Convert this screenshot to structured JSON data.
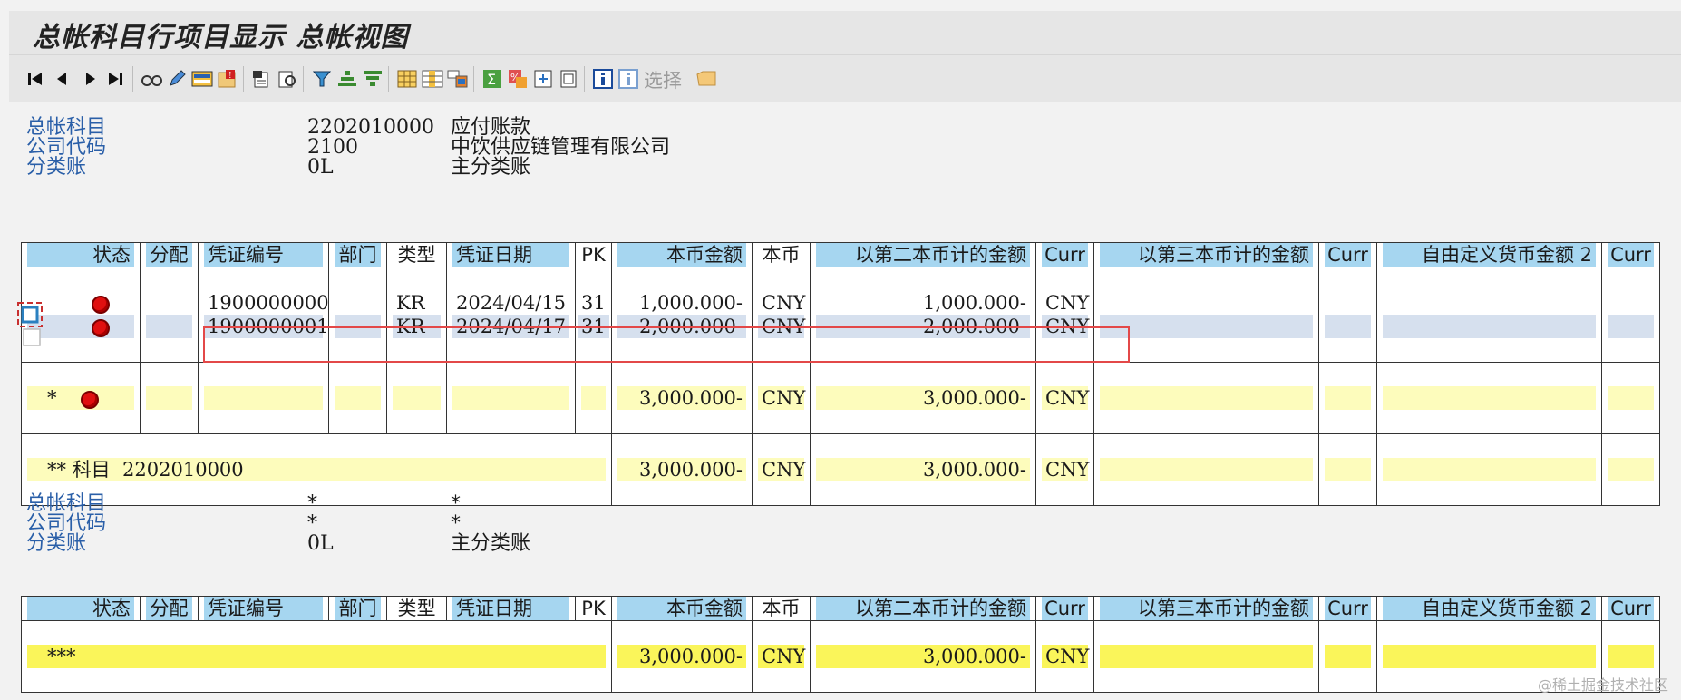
{
  "window": {
    "title": "总帐科目行项目显示 总帐视图"
  },
  "toolbar": {
    "icons": [
      "first-page-icon",
      "previous-page-icon",
      "next-page-icon",
      "last-page-icon",
      "glasses-icon",
      "pencil-icon",
      "layout-icon",
      "exception-icon",
      "document-icon",
      "find-icon",
      "filter-icon",
      "sort-ascending-icon",
      "sort-descending-icon",
      "table-icon",
      "columns-icon",
      "subtotal-layout-icon",
      "sum-icon",
      "subtotal-icon",
      "export-icon",
      "print-icon",
      "info-icon",
      "info-select-icon",
      "folder-icon"
    ],
    "select_label": "选择"
  },
  "header1": {
    "rows": [
      {
        "label": "总帐科目",
        "value": "2202010000",
        "desc": "应付账款"
      },
      {
        "label": "公司代码",
        "value": "2100",
        "desc": "中饮供应链管理有限公司"
      },
      {
        "label": "分类账",
        "value": "0L",
        "desc": "主分类账"
      }
    ]
  },
  "header2": {
    "rows": [
      {
        "label": "总帐科目",
        "value": "*",
        "desc": "*"
      },
      {
        "label": "公司代码",
        "value": "*",
        "desc": "*"
      },
      {
        "label": "分类账",
        "value": "0L",
        "desc": "主分类账"
      }
    ]
  },
  "columns": [
    "状态",
    "分配",
    "凭证编号",
    "部门",
    "类型",
    "凭证日期",
    "PK",
    "本币金额",
    "本币",
    "以第二本币计的金额",
    "Curr",
    "以第三本币计的金额",
    "Curr",
    "自由定义货币金额 2",
    "Curr"
  ],
  "table1": {
    "rows": [
      {
        "doc": "1900000000",
        "type": "KR",
        "date": "2024/04/15",
        "pk": "31",
        "amt": "1,000.000-",
        "cur": "CNY",
        "amt2": "1,000.000-",
        "cur2": "CNY"
      },
      {
        "doc": "1900000001",
        "type": "KR",
        "date": "2024/04/17",
        "pk": "31",
        "amt": "2,000.000-",
        "cur": "CNY",
        "amt2": "2,000.000-",
        "cur2": "CNY"
      }
    ],
    "subtotal": {
      "mark": "*",
      "amt": "3,000.000-",
      "cur": "CNY",
      "amt2": "3,000.000-",
      "cur2": "CNY"
    },
    "account_total": {
      "mark": "**",
      "label": "科目",
      "account": "2202010000",
      "amt": "3,000.000-",
      "cur": "CNY",
      "amt2": "3,000.000-",
      "cur2": "CNY"
    }
  },
  "table2": {
    "grand_total": {
      "mark": "***",
      "amt": "3,000.000-",
      "cur": "CNY",
      "amt2": "3,000.000-",
      "cur2": "CNY"
    }
  },
  "watermark": "@稀土掘金技术社区",
  "colors": {
    "status_red": "#e01010",
    "header_blue": "#a6d6f0",
    "subtotal_yellow": "#fdfcbc",
    "grand_total_yellow": "#faf55a",
    "selected_row": "#d6e0ee",
    "highlight_box": "#e34848"
  }
}
